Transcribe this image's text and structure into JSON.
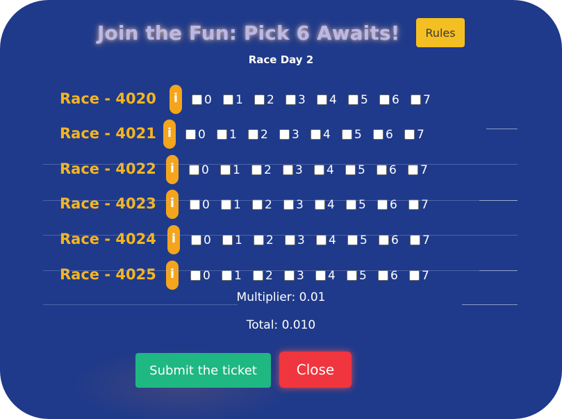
{
  "title": "Join the Fun: Pick 6 Awaits!",
  "rules_label": "Rules",
  "subtitle": "Race Day 2",
  "info_symbol": "i",
  "options": [
    "0",
    "1",
    "2",
    "3",
    "4",
    "5",
    "6",
    "7"
  ],
  "races": [
    {
      "label": "Race - 4020"
    },
    {
      "label": "Race - 4021"
    },
    {
      "label": "Race - 4022"
    },
    {
      "label": "Race - 4023"
    },
    {
      "label": "Race - 4024"
    },
    {
      "label": "Race - 4025"
    }
  ],
  "multiplier_text": "Multiplier: 0.01",
  "total_text": "Total: 0.010",
  "submit_label": "Submit the ticket",
  "close_label": "Close",
  "colors": {
    "background": "#1f3a8a",
    "race_label": "#f5b51f",
    "info_badge": "#f4a51c",
    "rules_button": "#f4bf22",
    "submit_button": "#1fb782",
    "close_button": "#f0353e"
  },
  "icons": {
    "info": "info-icon"
  }
}
